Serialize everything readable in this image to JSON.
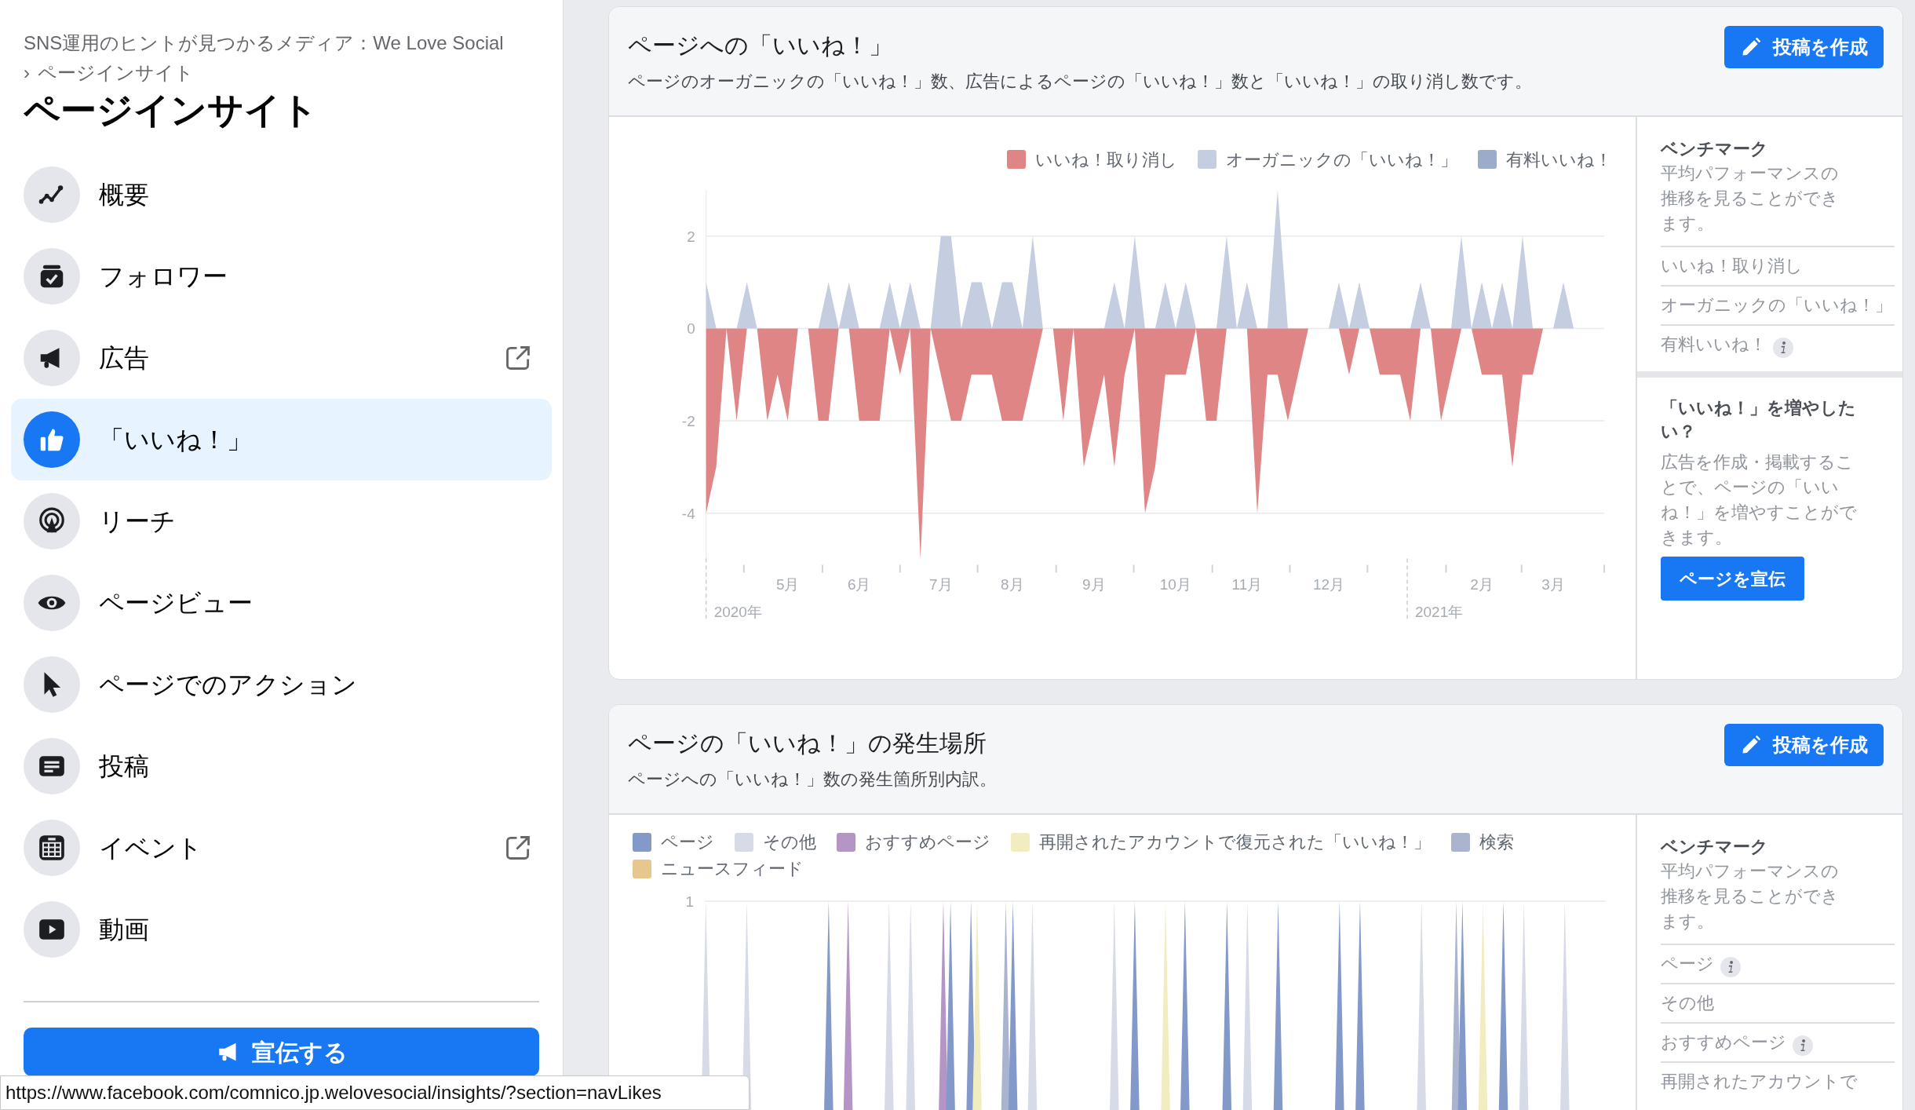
{
  "breadcrumb": {
    "items": [
      "SNS運用のヒントが見つかるメディア：We Love Social",
      "ページインサイト"
    ],
    "separator": "›"
  },
  "page_title": "ページインサイト",
  "nav": [
    {
      "label": "概要",
      "selected": false,
      "external": false
    },
    {
      "label": "フォロワー",
      "selected": false,
      "external": false
    },
    {
      "label": "広告",
      "selected": false,
      "external": true
    },
    {
      "label": "「いいね！」",
      "selected": true,
      "external": false
    },
    {
      "label": "リーチ",
      "selected": false,
      "external": false
    },
    {
      "label": "ページビュー",
      "selected": false,
      "external": false
    },
    {
      "label": "ページでのアクション",
      "selected": false,
      "external": false
    },
    {
      "label": "投稿",
      "selected": false,
      "external": false
    },
    {
      "label": "イベント",
      "selected": false,
      "external": true
    },
    {
      "label": "動画",
      "selected": false,
      "external": false
    }
  ],
  "promote_button": "宣伝する",
  "status_url": "https://www.facebook.com/comnico.jp.welovesocial/insights/?section=navLikes",
  "cards": [
    {
      "title": "ページへの「いいね！」",
      "subtitle": "ページのオーガニックの「いいね！」数、広告によるページの「いいね！」数と「いいね！」の取り消し数です。",
      "button": "投稿を作成",
      "year_labels": [
        "2020年",
        "2021年"
      ],
      "chart_data": {
        "type": "area",
        "grid": true,
        "yticks": [
          -4,
          -2,
          0,
          2
        ],
        "ylim": [
          -5,
          3
        ],
        "categories": [
          null,
          null,
          null,
          null,
          null,
          null,
          null,
          null,
          "5月",
          null,
          null,
          null,
          null,
          null,
          null,
          "6月",
          null,
          null,
          null,
          null,
          null,
          null,
          null,
          "7月",
          null,
          null,
          null,
          null,
          null,
          null,
          "8月",
          null,
          null,
          null,
          null,
          null,
          null,
          null,
          "9月",
          null,
          null,
          null,
          null,
          null,
          null,
          null,
          "10月",
          null,
          null,
          null,
          null,
          null,
          null,
          "11月",
          null,
          null,
          null,
          null,
          null,
          null,
          null,
          "12月",
          null,
          null,
          null,
          null,
          null,
          null,
          null,
          null,
          null,
          null,
          null,
          null,
          null,
          null,
          "2月",
          null,
          null,
          null,
          null,
          null,
          null,
          "3月",
          null,
          null,
          null,
          null,
          null
        ],
        "series": [
          {
            "name": "いいね！取り消し",
            "color": "#e08585",
            "values": [
              -4,
              -3,
              0,
              -2,
              0,
              0,
              -2,
              -1,
              -2,
              0,
              0,
              -2,
              -2,
              0,
              0,
              -2,
              -2,
              -2,
              0,
              -1,
              0,
              -5,
              0,
              -1,
              -2,
              -2,
              -1,
              -1,
              -1,
              -2,
              -2,
              -2,
              -1,
              0,
              0,
              -2,
              0,
              -3,
              -2,
              -1,
              -3,
              -1,
              0,
              -4,
              -3,
              -1,
              -1,
              -1,
              0,
              -2,
              -2,
              0,
              0,
              0,
              -4,
              -1,
              -1,
              -2,
              -1,
              0,
              0,
              0,
              0,
              -1,
              0,
              0,
              -1,
              -1,
              -1,
              -2,
              0,
              0,
              -2,
              -1,
              0,
              0,
              -1,
              -1,
              -1,
              -3,
              -1,
              -1,
              0,
              0,
              0,
              0,
              0,
              0,
              0
            ]
          },
          {
            "name": "オーガニックの「いいね！」",
            "color": "#c5cde0",
            "values": [
              1,
              0,
              0,
              0,
              1,
              0,
              0,
              0,
              0,
              0,
              0,
              0,
              1,
              0,
              1,
              0,
              0,
              0,
              1,
              0,
              1,
              0,
              0,
              2,
              2,
              0,
              1,
              1,
              0,
              1,
              1,
              0,
              2,
              0,
              0,
              0,
              0,
              0,
              0,
              0,
              1,
              0,
              2,
              0,
              0,
              1,
              0,
              1,
              0,
              0,
              0,
              2,
              0,
              1,
              0,
              0,
              3,
              0,
              0,
              0,
              0,
              0,
              1,
              0,
              1,
              0,
              0,
              0,
              0,
              0,
              1,
              0,
              0,
              0,
              2,
              0,
              1,
              0,
              1,
              0,
              2,
              0,
              0,
              0,
              1,
              0,
              0,
              0,
              0
            ]
          },
          {
            "name": "有料いいね！",
            "color": "#9dabcb",
            "values": [
              null,
              null,
              null,
              null,
              null,
              null,
              null,
              null,
              null,
              null,
              null,
              null,
              null,
              null,
              null,
              null,
              null,
              null,
              null,
              null,
              null,
              null,
              null,
              null,
              null,
              null,
              null,
              null,
              null,
              null,
              null,
              null,
              null,
              null,
              null,
              null,
              null,
              null,
              null,
              null,
              null,
              null,
              null,
              null,
              null,
              null,
              null,
              null,
              null,
              null,
              null,
              null,
              null,
              null,
              null,
              null,
              null,
              null,
              null,
              null,
              null,
              null,
              null,
              null,
              null,
              null,
              null,
              null,
              null,
              null,
              null,
              null,
              null,
              null,
              null,
              null,
              null,
              null,
              null,
              null,
              null,
              null,
              null,
              null,
              null,
              null,
              null,
              null,
              null
            ]
          }
        ]
      },
      "benchmark": {
        "title": "ベンチマーク",
        "description": "平均パフォーマンスの推移を見ることができます。",
        "items": [
          {
            "label": "いいね！取り消し",
            "info": false
          },
          {
            "label": "オーガニックの「いいね！」",
            "info": false
          },
          {
            "label": "有料いいね！",
            "info": true
          }
        ]
      },
      "promo": {
        "title": "「いいね！」を増やしたい？",
        "description": "広告を作成・掲載することで、ページの「いいね！」を増やすことができます。",
        "button": "ページを宣伝"
      }
    },
    {
      "title": "ページの「いいね！」の発生場所",
      "subtitle": "ページへの「いいね！」数の発生箇所別内訳。",
      "button": "投稿を作成",
      "legend": [
        {
          "label": "ページ",
          "color": "#8399c9"
        },
        {
          "label": "その他",
          "color": "#d7dbe7"
        },
        {
          "label": "おすすめページ",
          "color": "#b495c5"
        },
        {
          "label": "再開されたアカウントで復元された「いいね！」",
          "color": "#f1edc1"
        },
        {
          "label": "検索",
          "color": "#aab4cf"
        },
        {
          "label": "ニュースフィード",
          "color": "#e8c690"
        }
      ],
      "y_tick_label": "1",
      "benchmark": {
        "title": "ベンチマーク",
        "description": "平均パフォーマンスの推移を見ることができます。",
        "items": [
          {
            "label": "ページ",
            "info": true
          },
          {
            "label": "その他",
            "info": false
          },
          {
            "label": "おすすめページ",
            "info": true
          },
          {
            "label": "再開されたアカウントで",
            "info": false
          }
        ]
      }
    }
  ]
}
